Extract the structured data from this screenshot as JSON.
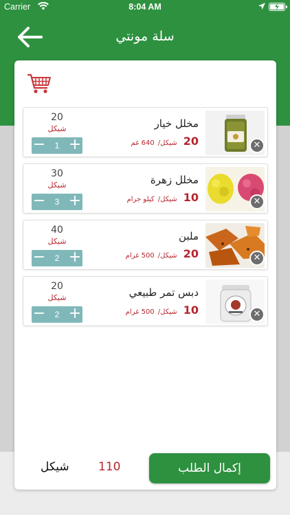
{
  "status_bar": {
    "carrier": "Carrier",
    "time": "8:04 AM"
  },
  "header": {
    "title": "سلة مونتي"
  },
  "colors": {
    "brand": "#2e9140",
    "price": "#b5262e",
    "stepper": "#80b8ba"
  },
  "cart": {
    "items": [
      {
        "name": "مخلل خيار",
        "price": "20",
        "currency_per": "شيكل/",
        "unit": "640 غم",
        "total": "20",
        "total_currency": "شيكل",
        "qty": "1",
        "image": "pickled-cucumber-jar"
      },
      {
        "name": "مخلل زهرة",
        "price": "10",
        "currency_per": "شيكل/",
        "unit": "كيلو جرام",
        "total": "30",
        "total_currency": "شيكل",
        "qty": "3",
        "image": "pickled-cauliflower"
      },
      {
        "name": "ملبن",
        "price": "20",
        "currency_per": "شيكل/",
        "unit": "500 غرام",
        "total": "40",
        "total_currency": "شيكل",
        "qty": "2",
        "image": "malban-sweets"
      },
      {
        "name": "دبس تمر طبيعي",
        "price": "10",
        "currency_per": "شيكل/",
        "unit": "500 غرام",
        "total": "20",
        "total_currency": "شيكل",
        "qty": "2",
        "image": "date-syrup-jar"
      }
    ]
  },
  "footer": {
    "currency": "شيكل",
    "total": "110",
    "checkout_label": "إكمال الطلب"
  }
}
